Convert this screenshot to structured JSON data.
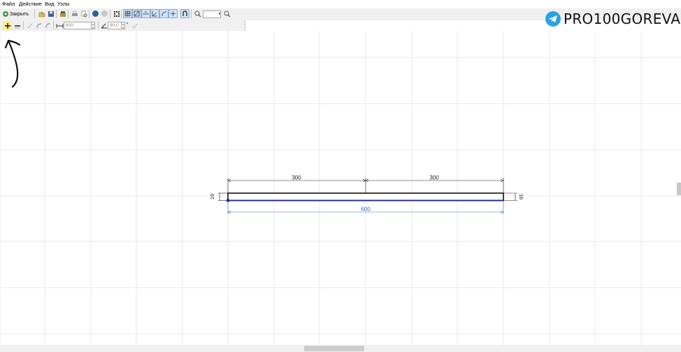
{
  "menu": {
    "items": [
      "Файл",
      "Действие",
      "Вид",
      "Узлы"
    ]
  },
  "toolbar": {
    "close_label": "Закрыть"
  },
  "toolbar2": {
    "length_value": "600",
    "angle_value": "90,0"
  },
  "drawing": {
    "dim_left": "300",
    "dim_right": "300",
    "dim_total": "600",
    "thickness_left": "16",
    "thickness_right": "16"
  },
  "watermark": {
    "text": "PRO100GOREVA"
  },
  "colors": {
    "selected_edge": "#1a2a9c",
    "dimension_blue": "#3a6fc4",
    "grid": "#e3e3e3",
    "highlight": "#f5f08a",
    "telegram": "#2aa3df"
  }
}
